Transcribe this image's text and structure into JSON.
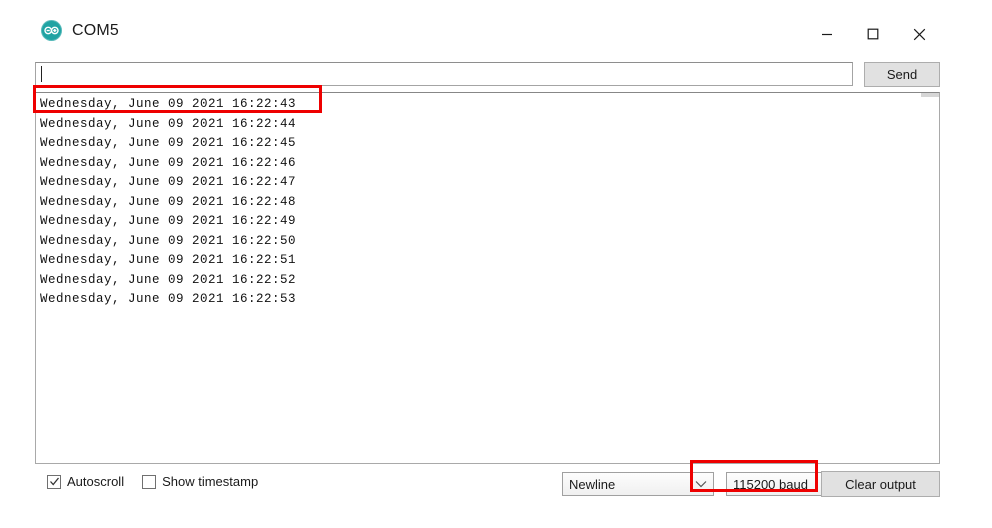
{
  "window": {
    "title": "COM5",
    "logo_icon": "arduino-infinity-icon",
    "controls": [
      {
        "name": "minimize",
        "icon": "minimize-icon",
        "label": "—"
      },
      {
        "name": "maximize",
        "icon": "maximize-icon",
        "label": "☐"
      },
      {
        "name": "close",
        "icon": "close-icon",
        "label": "✕"
      }
    ]
  },
  "send_row": {
    "input_value": "",
    "input_placeholder": "",
    "send_label": "Send"
  },
  "output": {
    "lines": [
      "Wednesday, June 09 2021 16:22:43",
      "Wednesday, June 09 2021 16:22:44",
      "Wednesday, June 09 2021 16:22:45",
      "Wednesday, June 09 2021 16:22:46",
      "Wednesday, June 09 2021 16:22:47",
      "Wednesday, June 09 2021 16:22:48",
      "Wednesday, June 09 2021 16:22:49",
      "Wednesday, June 09 2021 16:22:50",
      "Wednesday, June 09 2021 16:22:51",
      "Wednesday, June 09 2021 16:22:52",
      "Wednesday, June 09 2021 16:22:53"
    ]
  },
  "bottom_bar": {
    "autoscroll": {
      "label": "Autoscroll",
      "checked": true,
      "icon": "checkmark-icon"
    },
    "show_timestamp": {
      "label": "Show timestamp",
      "checked": false
    },
    "line_ending": {
      "value": "Newline",
      "icon": "chevron-down-icon"
    },
    "baud_rate": {
      "value": "115200 baud",
      "icon": "chevron-down-icon"
    },
    "clear_label": "Clear output"
  },
  "annotations": {
    "highlight_color": "#ee0000",
    "boxes": [
      {
        "name": "first-output-line-highlight"
      },
      {
        "name": "baud-rate-highlight"
      }
    ]
  }
}
